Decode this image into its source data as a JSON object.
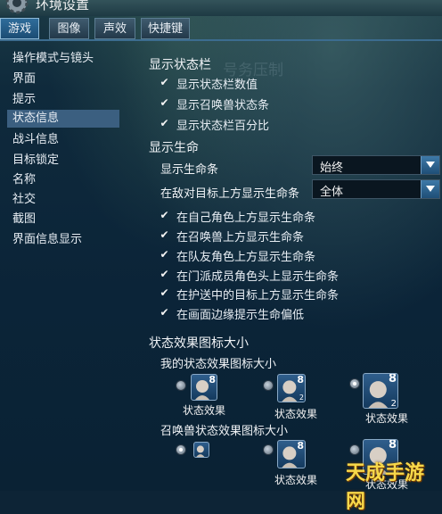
{
  "window": {
    "title": "环境设置"
  },
  "tabs": [
    {
      "label": "游戏",
      "active": true
    },
    {
      "label": "图像",
      "active": false
    },
    {
      "label": "声效",
      "active": false
    },
    {
      "label": "快捷键",
      "active": false
    }
  ],
  "sidebar": {
    "items": [
      {
        "label": "操作模式与镜头"
      },
      {
        "label": "界面"
      },
      {
        "label": "提示"
      },
      {
        "label": "状态信息",
        "active": true
      },
      {
        "label": "战斗信息"
      },
      {
        "label": "目标锁定"
      },
      {
        "label": "名称"
      },
      {
        "label": "社交"
      },
      {
        "label": "截图"
      },
      {
        "label": "界面信息显示"
      }
    ]
  },
  "statusbar": {
    "title": "显示状态栏",
    "ghost_text": "号务压制",
    "checks": [
      {
        "label": "显示状态栏数值",
        "checked": true
      },
      {
        "label": "显示召唤兽状态条",
        "checked": true
      },
      {
        "label": "显示状态栏百分比",
        "checked": true
      }
    ]
  },
  "health": {
    "title": "显示生命",
    "rows": [
      {
        "label": "显示生命条",
        "value": "始终"
      },
      {
        "label": "在敌对目标上方显示生命条",
        "value": "全体"
      }
    ],
    "checks": [
      {
        "label": "在自己角色上方显示生命条",
        "checked": true
      },
      {
        "label": "在召唤兽上方显示生命条",
        "checked": true
      },
      {
        "label": "在队友角色上方显示生命条",
        "checked": true
      },
      {
        "label": "在门派成员角色头上显示生命条",
        "checked": true
      },
      {
        "label": "在护送中的目标上方显示生命条",
        "checked": true
      },
      {
        "label": "在画面边缘提示生命偏低",
        "checked": true
      }
    ]
  },
  "buffsize": {
    "title": "状态效果图标大小",
    "mine": {
      "title": "我的状态效果图标大小",
      "options": [
        {
          "label": "状态效果",
          "selected": false,
          "num": "8",
          "sub": ""
        },
        {
          "label": "状态效果",
          "selected": false,
          "num": "8",
          "sub": "2"
        },
        {
          "label": "状态效果",
          "selected": true,
          "num": "8",
          "sub": "2"
        }
      ]
    },
    "summon": {
      "title": "召唤兽状态效果图标大小",
      "options": [
        {
          "label": "",
          "selected": true,
          "num": "",
          "sub": ""
        },
        {
          "label": "状态效果",
          "selected": false,
          "num": "8",
          "sub": ""
        },
        {
          "label": "状态效果",
          "selected": false,
          "num": "8",
          "sub": ""
        }
      ]
    }
  },
  "watermark": {
    "text": "天成手游网"
  },
  "colors": {
    "accent": "#2f6d9b",
    "selected_row": "#3b5f80",
    "panel_bg": "#0b2438"
  }
}
